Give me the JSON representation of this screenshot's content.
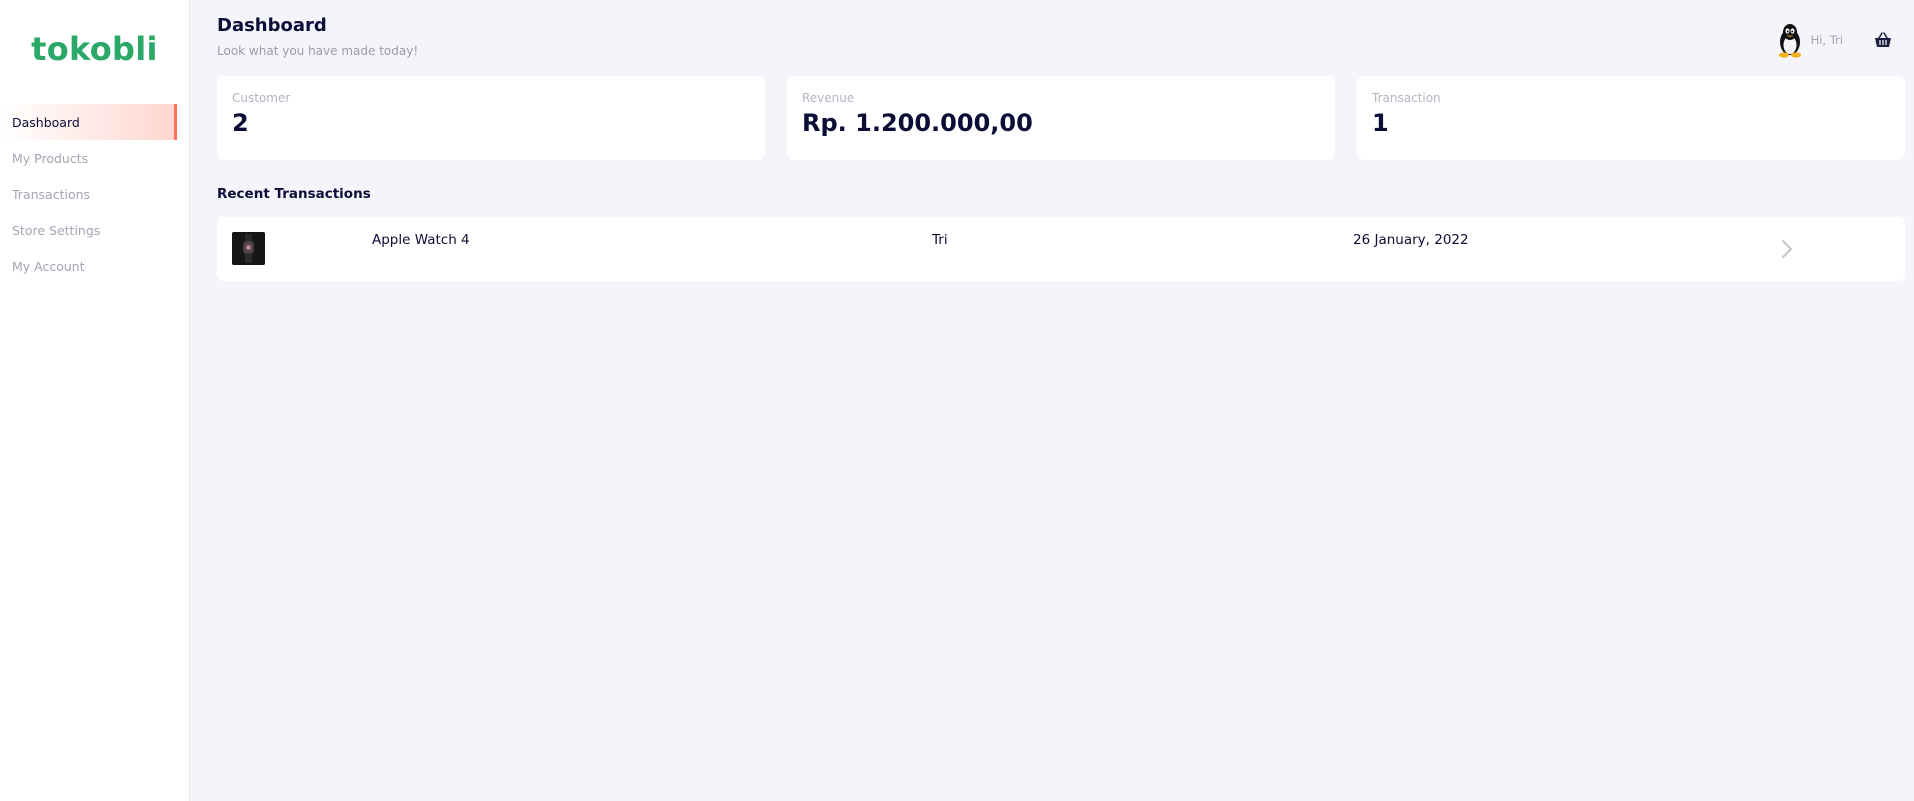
{
  "brand": {
    "name": "tokobli",
    "color": "#29a867"
  },
  "sidebar": {
    "items": [
      {
        "label": "Dashboard",
        "active": true
      },
      {
        "label": "My Products",
        "active": false
      },
      {
        "label": "Transactions",
        "active": false
      },
      {
        "label": "Store Settings",
        "active": false
      },
      {
        "label": "My Account",
        "active": false
      }
    ],
    "accent_color": "#ff7158"
  },
  "header": {
    "title": "Dashboard",
    "subtitle": "Look what you have made today!",
    "greeting": "Hi, Tri",
    "avatar_icon": "linux-penguin-avatar",
    "cart_icon": "basket-icon"
  },
  "stats": [
    {
      "label": "Customer",
      "value": "2"
    },
    {
      "label": "Revenue",
      "value": "Rp. 1.200.000,00"
    },
    {
      "label": "Transaction",
      "value": "1"
    }
  ],
  "recent_transactions": {
    "title": "Recent Transactions",
    "rows": [
      {
        "product": "Apple Watch 4",
        "customer": "Tri",
        "date": "26 January, 2022",
        "thumbnail_icon": "apple-watch-thumbnail"
      }
    ]
  }
}
